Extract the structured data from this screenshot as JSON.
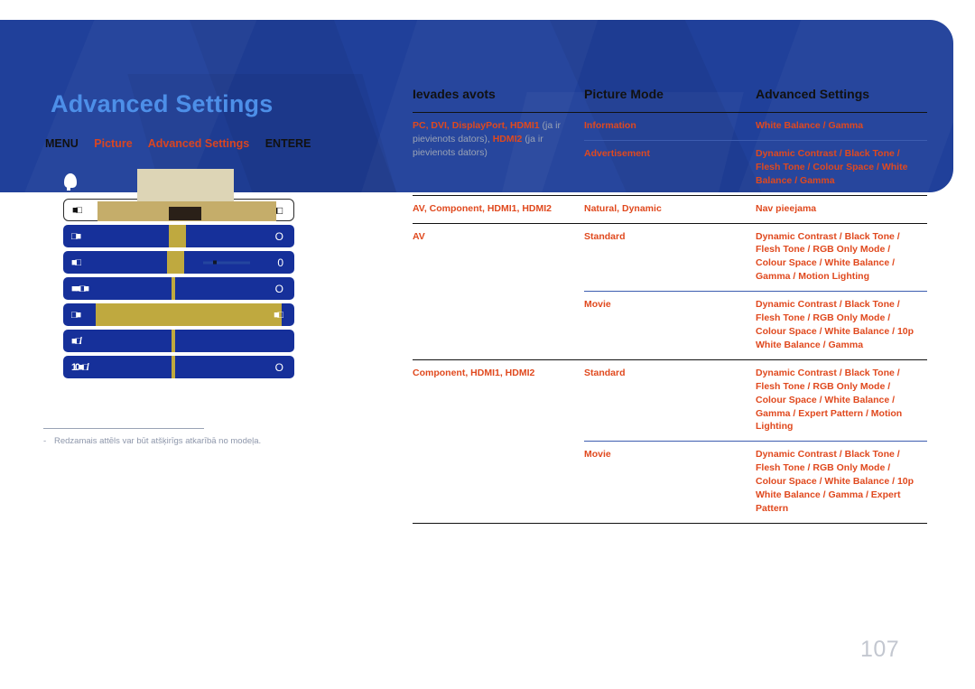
{
  "page": {
    "title": "Advanced Settings",
    "number": "107",
    "footnote_marker": "-",
    "footnote": "Redzamais attēls var būt atšķirīgs atkarībā no modeļa.",
    "accent_color": "#d94521",
    "banner_color": "#20409a",
    "title_color": "#4d8fe8"
  },
  "breadcrumb": {
    "items": [
      {
        "label": "MENU",
        "style": "dark"
      },
      {
        "label": "Picture",
        "style": "accent"
      },
      {
        "label": "Advanced Settings",
        "style": "accent"
      },
      {
        "label": "ENTERE",
        "style": "dark"
      }
    ]
  },
  "osd": {
    "rows": [
      {
        "label": "■□",
        "value": "■□",
        "type": "selected-white"
      },
      {
        "label": "□■",
        "value": "O",
        "type": "slider-wide"
      },
      {
        "label": "■□",
        "value": "0",
        "type": "slider-wide-track"
      },
      {
        "label": "■■□■",
        "value": "O",
        "type": "slider-thin"
      },
      {
        "label": "□■",
        "value": "■□",
        "type": "fill-gold"
      },
      {
        "label": "■□/",
        "value": "",
        "type": "slider-thin"
      },
      {
        "label": "10■□/",
        "value": "O",
        "type": "slider-thin"
      }
    ]
  },
  "table": {
    "headers": [
      "Ievades avots",
      "Picture Mode",
      "Advanced Settings"
    ],
    "rows": [
      {
        "source_main": "PC, DVI, DisplayPort, HDMI1",
        "source_note1": "(ja ir pievienots dators),",
        "source_main2": "HDMI2",
        "source_note2": "(ja ir pievienots",
        "source_note3": "dators)",
        "groups": [
          {
            "mode": "Information",
            "settings": "White Balance / Gamma",
            "settings_available": true
          },
          {
            "mode": "Advertisement",
            "settings": "Dynamic Contrast / Black Tone / Flesh Tone / Colour Space / White Balance / Gamma",
            "settings_available": true
          }
        ]
      },
      {
        "source_main": "AV, Component, HDMI1, HDMI2",
        "groups": [
          {
            "mode": "Natural, Dynamic",
            "settings": "Nav pieejama",
            "settings_available": false
          }
        ]
      },
      {
        "source_main": "AV",
        "groups": [
          {
            "mode": "Standard",
            "settings": "Dynamic Contrast / Black Tone / Flesh Tone / RGB Only Mode / Colour Space / White Balance / Gamma / Motion Lighting",
            "settings_available": true
          },
          {
            "mode": "Movie",
            "settings": "Dynamic Contrast / Black Tone / Flesh Tone / RGB Only Mode / Colour Space / White Balance / 10p White Balance / Gamma",
            "settings_available": true
          }
        ]
      },
      {
        "source_main": "Component, HDMI1, HDMI2",
        "groups": [
          {
            "mode": "Standard",
            "settings": "Dynamic Contrast / Black Tone / Flesh Tone / RGB Only Mode / Colour Space / White Balance / Gamma / Expert Pattern / Motion Lighting",
            "settings_available": true
          },
          {
            "mode": "Movie",
            "settings": "Dynamic Contrast / Black Tone / Flesh Tone / RGB Only Mode / Colour Space / White Balance / 10p White Balance / Gamma / Expert Pattern",
            "settings_available": true
          }
        ]
      }
    ]
  }
}
